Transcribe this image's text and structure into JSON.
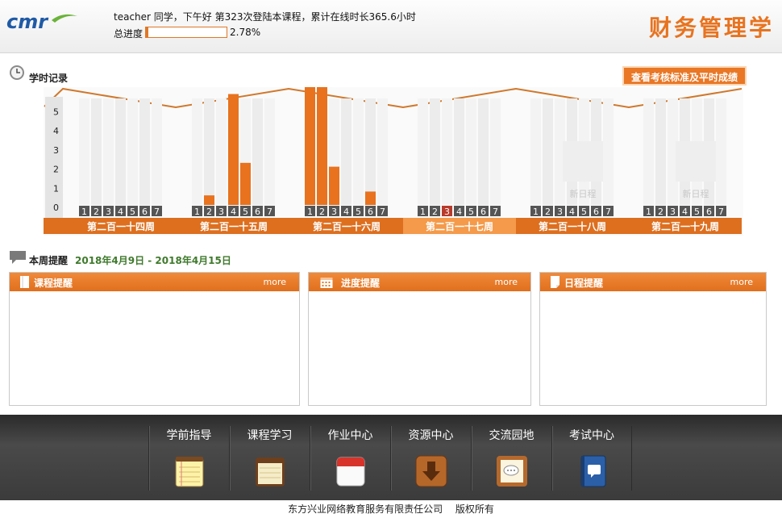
{
  "header": {
    "logo_text": "cmr",
    "greeting": "teacher 同学，下午好 第323次登陆本课程，累计在线时长365.6小时",
    "progress_label": "总进度",
    "progress_percent": "2.78%",
    "progress_value": 0.0278,
    "course_title": "财务管理学"
  },
  "record": {
    "title": "学时记录",
    "score_button": "查看考核标准及平时成绩"
  },
  "chart_data": {
    "type": "bar",
    "y_ticks": [
      "5",
      "4",
      "3",
      "2",
      "1",
      "0"
    ],
    "ylim": [
      0,
      5
    ],
    "day_labels": [
      "1",
      "2",
      "3",
      "4",
      "5",
      "6",
      "7"
    ],
    "new_schedule_label": "新日程",
    "current_week_index": 3,
    "today_day_index": 2,
    "colors": {
      "bar": "#e8721e",
      "band": "#dd6f1f",
      "band_current": "#f49a4a",
      "today": "#b83a2a"
    },
    "weeks": [
      {
        "label": "第二百一十四周",
        "values": [
          0,
          0,
          0,
          0,
          0,
          0,
          0
        ],
        "placeholder": false
      },
      {
        "label": "第二百一十五周",
        "values": [
          0,
          0.5,
          0,
          5.8,
          2.2,
          0,
          0
        ],
        "placeholder": false
      },
      {
        "label": "第二百一十六周",
        "values": [
          6.2,
          6.2,
          2.0,
          0,
          0,
          0.7,
          0
        ],
        "placeholder": false
      },
      {
        "label": "第二百一十七周",
        "values": [
          0,
          0,
          0,
          0,
          0,
          0,
          0
        ],
        "placeholder": false
      },
      {
        "label": "第二百一十八周",
        "values": [
          0,
          0,
          0,
          0,
          0,
          0,
          0
        ],
        "placeholder": true
      },
      {
        "label": "第二百一十九周",
        "values": [
          0,
          0,
          0,
          0,
          0,
          0,
          0
        ],
        "placeholder": true
      }
    ]
  },
  "reminders": {
    "title": "本周提醒",
    "date_range": "2018年4月9日 - 2018年4月15日",
    "panels": [
      {
        "title": "课程提醒",
        "more": "more"
      },
      {
        "title": "进度提醒",
        "more": "more"
      },
      {
        "title": "日程提醒",
        "more": "more"
      }
    ]
  },
  "nav": {
    "items": [
      {
        "label": "学前指导",
        "icon": "notepad-icon"
      },
      {
        "label": "课程学习",
        "icon": "notes-icon"
      },
      {
        "label": "作业中心",
        "icon": "calendar-icon"
      },
      {
        "label": "资源中心",
        "icon": "download-icon"
      },
      {
        "label": "交流园地",
        "icon": "chat-board-icon"
      },
      {
        "label": "考试中心",
        "icon": "address-book-icon"
      }
    ]
  },
  "footer": {
    "company": "东方兴业网络教育服务有限责任公司",
    "rights": "版权所有"
  }
}
